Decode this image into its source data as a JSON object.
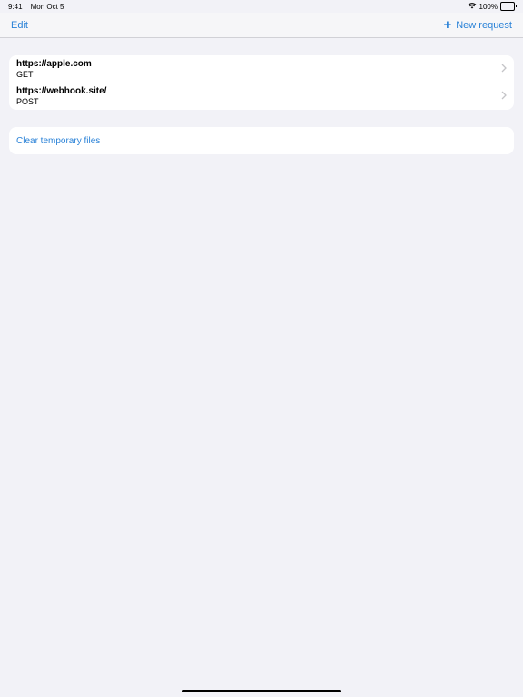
{
  "status_bar": {
    "time": "9:41",
    "date": "Mon Oct 5",
    "battery": "100%"
  },
  "nav": {
    "edit_label": "Edit",
    "new_request_label": "New request"
  },
  "requests": [
    {
      "url": "https://apple.com",
      "method": "GET"
    },
    {
      "url": "https://webhook.site/",
      "method": "POST"
    }
  ],
  "actions": {
    "clear_label": "Clear temporary files"
  },
  "colors": {
    "accent": "#2a82d7",
    "background": "#f2f2f7"
  }
}
